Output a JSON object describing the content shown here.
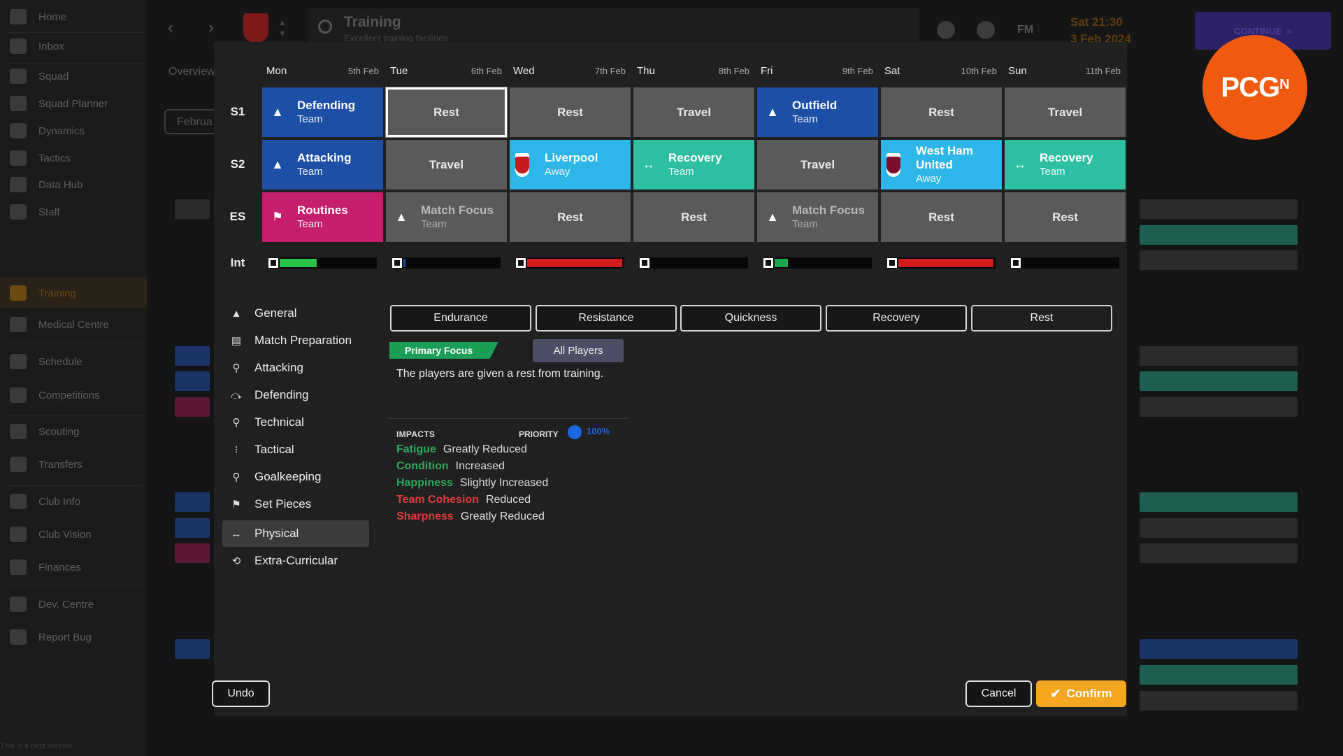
{
  "sidebar": {
    "items": [
      {
        "label": "Home"
      },
      {
        "label": "Inbox"
      },
      {
        "label": "Squad"
      },
      {
        "label": "Squad Planner"
      },
      {
        "label": "Dynamics"
      },
      {
        "label": "Tactics"
      },
      {
        "label": "Data Hub"
      },
      {
        "label": "Staff"
      },
      {
        "label": "Training"
      },
      {
        "label": "Medical Centre"
      },
      {
        "label": "Schedule"
      },
      {
        "label": "Competitions"
      },
      {
        "label": "Scouting"
      },
      {
        "label": "Transfers"
      },
      {
        "label": "Club Info"
      },
      {
        "label": "Club Vision"
      },
      {
        "label": "Finances"
      },
      {
        "label": "Dev. Centre"
      },
      {
        "label": "Report Bug"
      }
    ],
    "beta_note": "This is a beta version"
  },
  "topbar": {
    "title": "Training",
    "subtitle": "Excellent training facilities",
    "fm_label": "FM",
    "time": "Sat 21:30",
    "date": "3 Feb 2024",
    "continue_label": "CONTINUE"
  },
  "background": {
    "overview_tab": "Overview",
    "month_button": "Februa"
  },
  "schedule": {
    "days": [
      {
        "name": "Mon",
        "date": "5th Feb"
      },
      {
        "name": "Tue",
        "date": "6th Feb"
      },
      {
        "name": "Wed",
        "date": "7th Feb"
      },
      {
        "name": "Thu",
        "date": "8th Feb"
      },
      {
        "name": "Fri",
        "date": "9th Feb"
      },
      {
        "name": "Sat",
        "date": "10th Feb"
      },
      {
        "name": "Sun",
        "date": "11th Feb"
      }
    ],
    "row_labels": {
      "s1": "S1",
      "s2": "S2",
      "es": "ES",
      "int": "Int"
    },
    "s1": [
      {
        "title": "Defending",
        "sub": "Team",
        "color": "#1e4fa6",
        "icon": "cone-icon"
      },
      {
        "title": "Rest",
        "color": "#5a5a5a",
        "selected": true
      },
      {
        "title": "Rest",
        "color": "#5a5a5a"
      },
      {
        "title": "Travel",
        "color": "#5a5a5a"
      },
      {
        "title": "Outfield",
        "sub": "Team",
        "color": "#1e4fa6",
        "icon": "cone-icon"
      },
      {
        "title": "Rest",
        "color": "#5a5a5a"
      },
      {
        "title": "Travel",
        "color": "#5a5a5a"
      }
    ],
    "s2": [
      {
        "title": "Attacking",
        "sub": "Team",
        "color": "#1e4fa6",
        "icon": "cone-icon"
      },
      {
        "title": "Travel",
        "color": "#5a5a5a"
      },
      {
        "title": "Liverpool",
        "sub": "Away",
        "color": "#2fb6e8",
        "icon": "club-crest-icon"
      },
      {
        "title": "Recovery",
        "sub": "Team",
        "color": "#2ebfa3",
        "icon": "recovery-icon"
      },
      {
        "title": "Travel",
        "color": "#5a5a5a"
      },
      {
        "title": "West Ham United",
        "sub": "Away",
        "color": "#2fb6e8",
        "icon": "club-crest-icon"
      },
      {
        "title": "Recovery",
        "sub": "Team",
        "color": "#2ebfa3",
        "icon": "recovery-icon"
      }
    ],
    "es": [
      {
        "title": "Routines",
        "sub": "Team",
        "color": "#c41e6c",
        "icon": "set-piece-icon"
      },
      {
        "title": "Match Focus",
        "sub": "Team",
        "color": "#5a5a5a",
        "icon": "cone-icon"
      },
      {
        "title": "Rest",
        "color": "#5a5a5a"
      },
      {
        "title": "Rest",
        "color": "#5a5a5a"
      },
      {
        "title": "Match Focus",
        "sub": "Team",
        "color": "#5a5a5a",
        "icon": "cone-icon"
      },
      {
        "title": "Rest",
        "color": "#5a5a5a"
      },
      {
        "title": "Rest",
        "color": "#5a5a5a"
      }
    ],
    "intensity": [
      {
        "level": 0.39,
        "color": "#29c146"
      },
      {
        "level": 0.02,
        "color": "#1e4fa6"
      },
      {
        "level": 0.99,
        "color": "#d11c1c"
      },
      {
        "level": 0.0,
        "color": "#29c146"
      },
      {
        "level": 0.14,
        "color": "#1aa850"
      },
      {
        "level": 0.99,
        "color": "#d11c1c"
      },
      {
        "level": 0.0,
        "color": "#29c146"
      }
    ]
  },
  "categories": [
    {
      "label": "General",
      "icon": "cone-icon"
    },
    {
      "label": "Match Preparation",
      "icon": "clipboard-icon"
    },
    {
      "label": "Attacking",
      "icon": "running-player-icon"
    },
    {
      "label": "Defending",
      "icon": "tackle-icon"
    },
    {
      "label": "Technical",
      "icon": "dribble-icon"
    },
    {
      "label": "Tactical",
      "icon": "tactics-icon"
    },
    {
      "label": "Goalkeeping",
      "icon": "goalkeeper-icon"
    },
    {
      "label": "Set Pieces",
      "icon": "corner-flag-icon"
    },
    {
      "label": "Physical",
      "icon": "dumbbell-icon",
      "active": true
    },
    {
      "label": "Extra-Curricular",
      "icon": "extra-curricular-icon"
    }
  ],
  "sessions": [
    {
      "label": "Endurance"
    },
    {
      "label": "Resistance"
    },
    {
      "label": "Quickness"
    },
    {
      "label": "Recovery"
    },
    {
      "label": "Rest",
      "active": true
    }
  ],
  "detail": {
    "primary_focus": "Primary Focus",
    "all_players": "All Players",
    "description": "The players are given a rest from training.",
    "impacts_label": "IMPACTS",
    "priority_label": "PRIORITY",
    "priority_value": "100%",
    "impacts": [
      {
        "key": "Fatigue",
        "value": "Greatly Reduced",
        "tone": "good"
      },
      {
        "key": "Condition",
        "value": "Increased",
        "tone": "good"
      },
      {
        "key": "Happiness",
        "value": "Slightly Increased",
        "tone": "good"
      },
      {
        "key": "Team Cohesion",
        "value": "Reduced",
        "tone": "bad"
      },
      {
        "key": "Sharpness",
        "value": "Greatly Reduced",
        "tone": "bad"
      }
    ]
  },
  "footer": {
    "undo": "Undo",
    "cancel": "Cancel",
    "confirm": "Confirm"
  },
  "watermark": {
    "text": "PCG",
    "sup": "N"
  }
}
